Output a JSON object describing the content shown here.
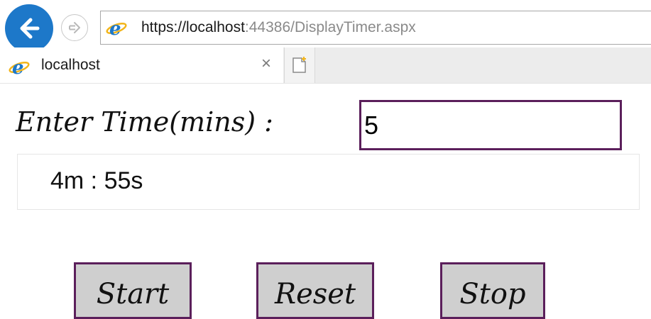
{
  "browser": {
    "url_scheme": "https://",
    "url_host": "localhost",
    "url_rest": ":44386/DisplayTimer.aspx",
    "tab_title": "localhost",
    "tab_close_glyph": "×",
    "accent": "#1d78c9"
  },
  "form": {
    "time_label": "Enter Time(mins) :",
    "time_value": "5",
    "timer_display": "4m : 55s",
    "buttons": {
      "start": "Start",
      "reset": "Reset",
      "stop": "Stop"
    },
    "border_color": "#5b1f5b",
    "button_bg": "#cfcfcf"
  },
  "icons": [
    "back-arrow-icon",
    "forward-arrow-icon",
    "ie-logo-icon",
    "close-icon",
    "new-tab-icon"
  ]
}
